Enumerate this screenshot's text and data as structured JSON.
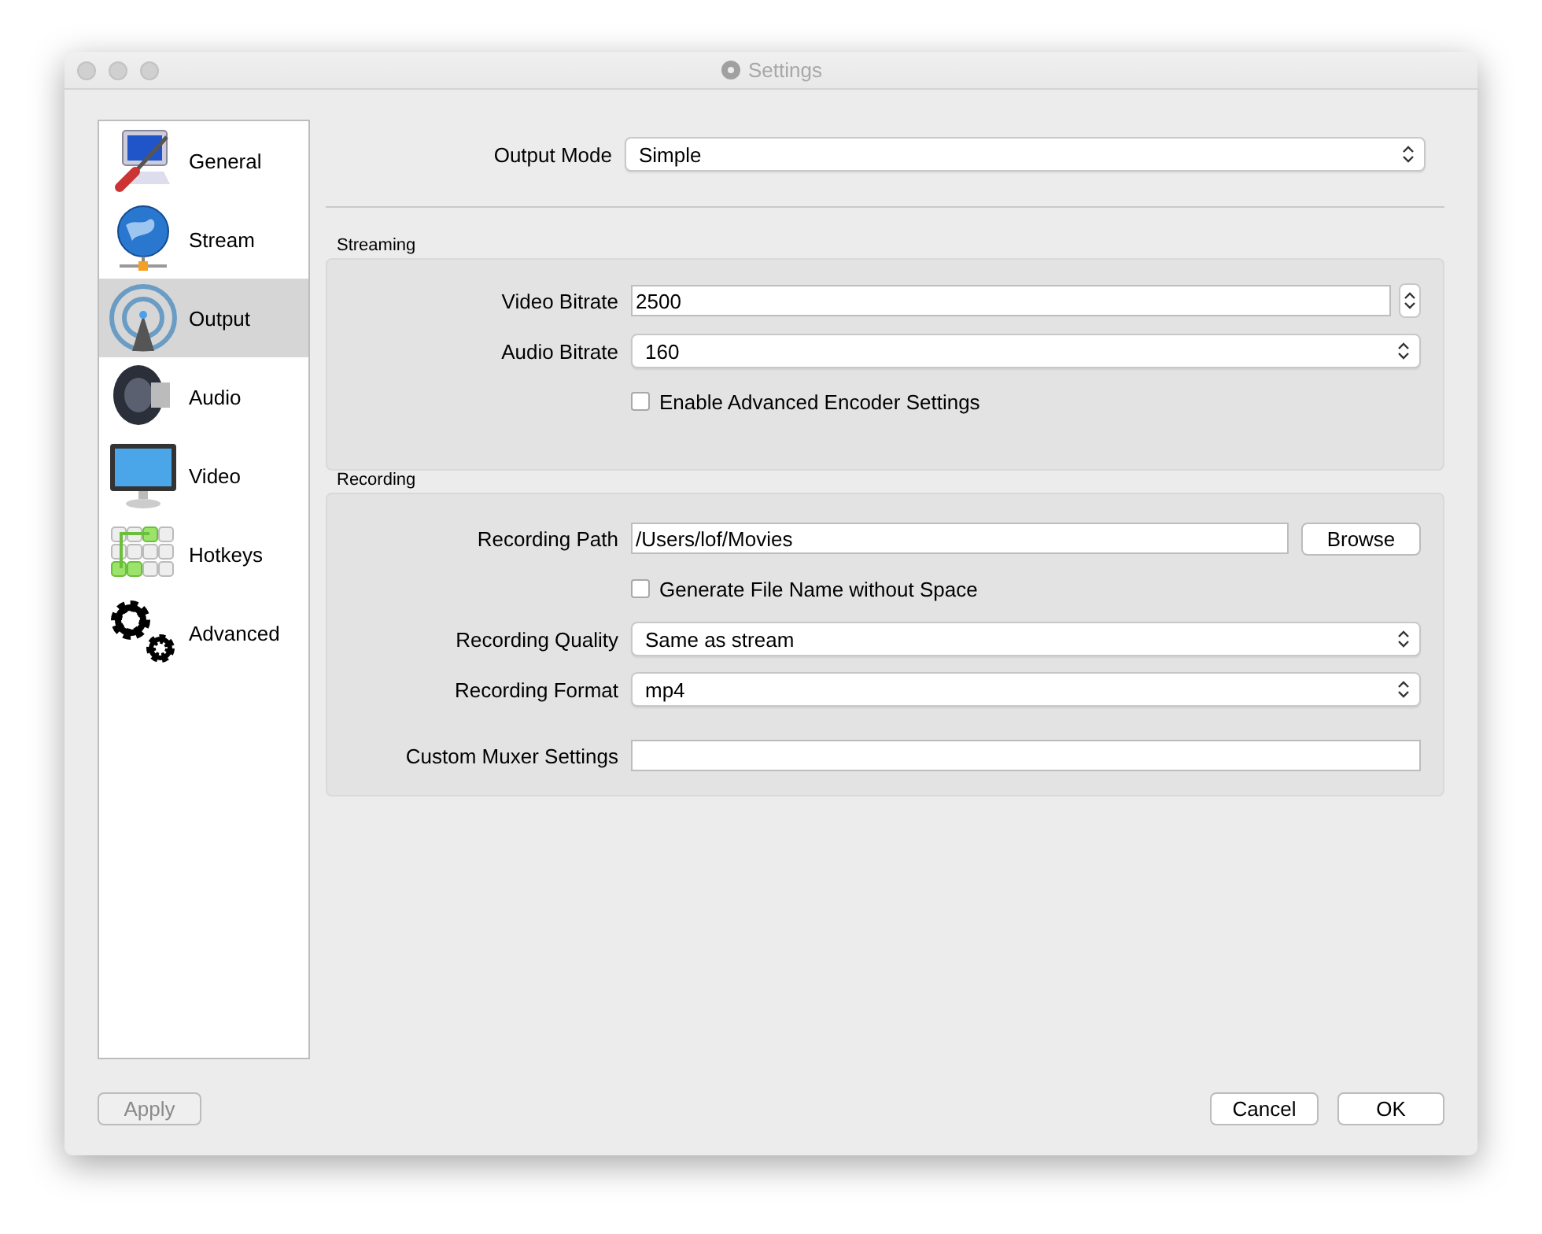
{
  "window": {
    "title": "Settings"
  },
  "sidebar": {
    "items": [
      {
        "label": "General",
        "selected": false
      },
      {
        "label": "Stream",
        "selected": false
      },
      {
        "label": "Output",
        "selected": true
      },
      {
        "label": "Audio",
        "selected": false
      },
      {
        "label": "Video",
        "selected": false
      },
      {
        "label": "Hotkeys",
        "selected": false
      },
      {
        "label": "Advanced",
        "selected": false
      }
    ]
  },
  "output_mode": {
    "label": "Output Mode",
    "value": "Simple"
  },
  "groups": [
    {
      "title": "Streaming",
      "rows": [
        {
          "kind": "spinbox",
          "label": "Video Bitrate",
          "value": "2500"
        },
        {
          "kind": "select",
          "label": "Audio Bitrate",
          "value": "160"
        },
        {
          "kind": "checkbox",
          "label": "Enable Advanced Encoder Settings",
          "checked": false
        }
      ]
    },
    {
      "title": "Recording",
      "rows": [
        {
          "kind": "path",
          "label": "Recording Path",
          "value": "/Users/lof/Movies",
          "button": "Browse"
        },
        {
          "kind": "checkbox",
          "label": "Generate File Name without Space",
          "checked": false
        },
        {
          "kind": "select",
          "label": "Recording Quality",
          "value": "Same as stream"
        },
        {
          "kind": "select",
          "label": "Recording Format",
          "value": "mp4"
        },
        {
          "kind": "text",
          "label": "Custom Muxer Settings",
          "value": ""
        }
      ]
    }
  ],
  "buttons": {
    "apply": {
      "label": "Apply",
      "disabled": true
    },
    "cancel": {
      "label": "Cancel"
    },
    "ok": {
      "label": "OK"
    }
  }
}
